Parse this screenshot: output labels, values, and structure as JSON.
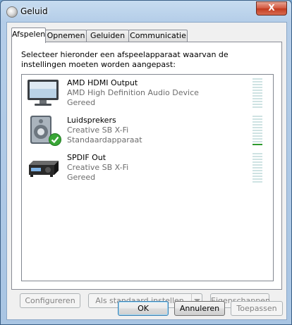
{
  "window": {
    "title": "Geluid",
    "close_label": "X"
  },
  "tabs": [
    {
      "label": "Afspelen",
      "active": true
    },
    {
      "label": "Opnemen",
      "active": false
    },
    {
      "label": "Geluiden",
      "active": false
    },
    {
      "label": "Communicatie",
      "active": false
    }
  ],
  "instructions": "Selecteer hieronder een afspeelapparaat waarvan de instellingen moeten worden aangepast:",
  "devices": [
    {
      "name": "AMD HDMI Output",
      "description": "AMD High Definition Audio Device",
      "status": "Gereed",
      "icon": "monitor-icon",
      "level": 0,
      "is_default": false
    },
    {
      "name": "Luidsprekers",
      "description": "Creative SB X-Fi",
      "status": "Standaardapparaat",
      "icon": "speaker-icon",
      "level": 0.1,
      "is_default": true
    },
    {
      "name": "SPDIF Out",
      "description": "Creative SB X-Fi",
      "status": "Gereed",
      "icon": "receiver-icon",
      "level": 0,
      "is_default": false
    }
  ],
  "actions": {
    "configure": "Configureren",
    "set_default": "Als standaard instellen",
    "properties": "Eigenschappen"
  },
  "dialog_buttons": {
    "ok": "OK",
    "cancel": "Annuleren",
    "apply": "Toepassen"
  },
  "colors": {
    "meter_on": "#2f9a2f",
    "meter_off": "#cfe3e3",
    "check": "#3aa637"
  }
}
